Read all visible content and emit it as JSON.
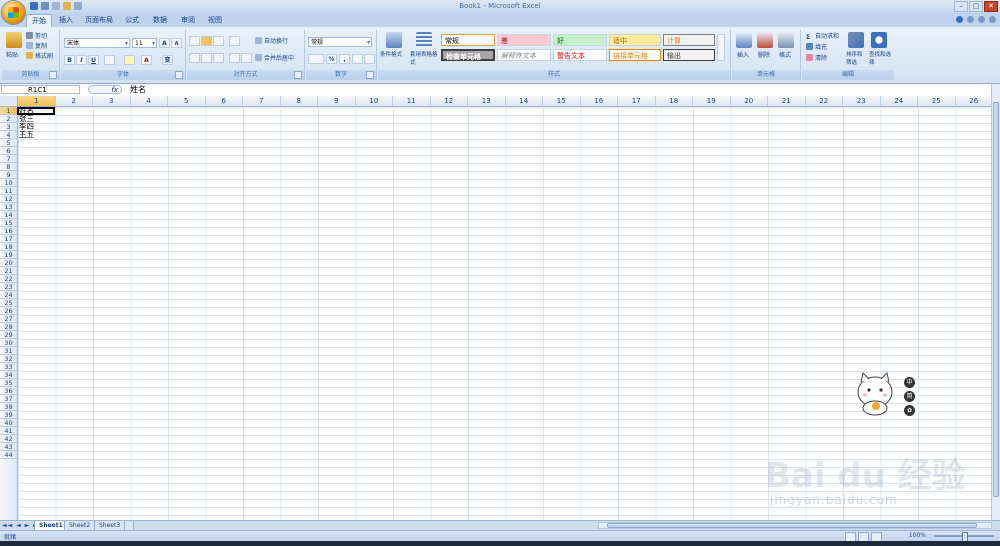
{
  "window": {
    "title": "Book1 - Microsoft Excel",
    "controls": [
      "–",
      "□",
      "✕"
    ]
  },
  "tabs": [
    "开始",
    "插入",
    "页面布局",
    "公式",
    "数据",
    "审阅",
    "视图"
  ],
  "ribbon": {
    "clipboard": {
      "label": "剪贴板",
      "paste": "粘贴",
      "cut": "剪切",
      "copy": "复制",
      "format_painter": "格式刷"
    },
    "font": {
      "label": "字体",
      "font_name": "宋体",
      "font_size": "11",
      "grow": "A",
      "shrink": "A",
      "bold": "B",
      "italic": "I",
      "underline": "U",
      "font_color_letter": "A",
      "phonetic": "变"
    },
    "alignment": {
      "label": "对齐方式",
      "wrap_text": "自动换行",
      "merge_center": "合并后居中"
    },
    "number": {
      "label": "数字",
      "format": "常规",
      "percent": "%",
      "comma": ","
    },
    "styles": {
      "label": "样式",
      "conditional_formatting": "条件格式",
      "format_as_table": "套用表格格式",
      "cells": [
        "常规",
        "差",
        "好",
        "适中",
        "计算",
        "检查单元格",
        "解释性文本",
        "警告文本",
        "链接单元格",
        "输出"
      ]
    },
    "cells": {
      "label": "单元格",
      "insert": "插入",
      "delete": "删除",
      "format": "格式"
    },
    "editing": {
      "label": "编辑",
      "autosum": "自动求和",
      "fill": "填充",
      "clear": "清除",
      "sort_filter": "排序和筛选",
      "find_select": "查找和选择"
    }
  },
  "formula_bar": {
    "name_box": "R1C1",
    "fx": "fx",
    "content": "姓名"
  },
  "columns": [
    "1",
    "2",
    "3",
    "4",
    "5",
    "6",
    "7",
    "8",
    "9",
    "10",
    "11",
    "12",
    "13",
    "14",
    "15",
    "16",
    "17",
    "18",
    "19",
    "20",
    "21",
    "22",
    "23",
    "24",
    "25",
    "26"
  ],
  "rows": [
    "1",
    "2",
    "3",
    "4",
    "5",
    "6",
    "7",
    "8",
    "9",
    "10",
    "11",
    "12",
    "13",
    "14",
    "15",
    "16",
    "17",
    "18",
    "19",
    "20",
    "21",
    "22",
    "23",
    "24",
    "25",
    "26",
    "27",
    "28",
    "29",
    "30",
    "31",
    "32",
    "33",
    "34",
    "35",
    "36",
    "37",
    "38",
    "39",
    "40",
    "41",
    "42",
    "43",
    "44"
  ],
  "cells": {
    "r1c1": "姓名",
    "r2c1": "张三",
    "r3c1": "李四",
    "r4c1": "王五"
  },
  "sheets": [
    "Sheet1",
    "Sheet2",
    "Sheet3"
  ],
  "sheet_nav": "◄◄ ◄ ► ►►",
  "status": {
    "text": "就绪",
    "zoom": "100%"
  },
  "overlay": {
    "watermark": "Bai du 经验",
    "watermark_url": "jingyan.baidu.com",
    "side_icons": [
      "中",
      "简",
      "✿"
    ]
  },
  "colors": {
    "ribbon": "#d3e2f4",
    "header_selected": "#f1bf55",
    "accent": "#15428b"
  }
}
